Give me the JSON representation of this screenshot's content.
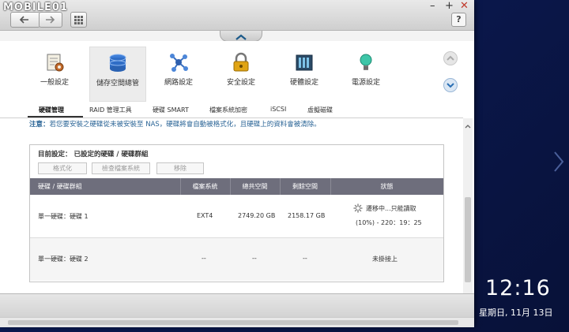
{
  "watermark": "MOBILE01",
  "window_controls": {
    "minimize": "–",
    "maximize": "+",
    "close": "✕"
  },
  "help_label": "?",
  "nav": {
    "back_icon": "back-arrow-icon",
    "forward_icon": "forward-arrow-icon",
    "apps_icon": "grid-icon"
  },
  "icons": [
    {
      "label": "一般設定",
      "icon": "general-settings-icon"
    },
    {
      "label": "儲存空間總管",
      "icon": "storage-manager-icon"
    },
    {
      "label": "網路設定",
      "icon": "network-icon"
    },
    {
      "label": "安全設定",
      "icon": "lock-icon"
    },
    {
      "label": "硬體設定",
      "icon": "hardware-icon"
    },
    {
      "label": "電源設定",
      "icon": "power-bulb-icon"
    }
  ],
  "tabs": [
    "硬碟管理",
    "RAID 管理工具",
    "硬碟 SMART",
    "檔案系統加密",
    "iSCSI",
    "虛擬磁碟"
  ],
  "notice": {
    "prefix": "注意：",
    "text": "若您要安裝之硬碟從未被安裝至 NAS，硬碟將會自動被格式化，且硬碟上的資料會被清除。"
  },
  "panel": {
    "title": "目前設定： 已設定的硬碟 / 硬碟群組",
    "buttons": [
      "格式化",
      "檢查檔案系統",
      "移除"
    ]
  },
  "table": {
    "headers": [
      "硬碟 / 硬碟群組",
      "檔案系統",
      "總共空間",
      "剩餘空間",
      "狀態"
    ],
    "rows": [
      {
        "name": "單一硬碟：硬碟 1",
        "fs": "EXT4",
        "total": "2749.20 GB",
        "free": "2158.17 GB",
        "status": "遷移中...只能讀取",
        "progress": "(10%) - 220：19：25"
      },
      {
        "name": "單一硬碟：硬碟 2",
        "fs": "--",
        "total": "--",
        "free": "--",
        "status": "未掛接上",
        "progress": ""
      }
    ]
  },
  "clock": {
    "time": "12:16",
    "date": "星期日, 11月 13日"
  }
}
